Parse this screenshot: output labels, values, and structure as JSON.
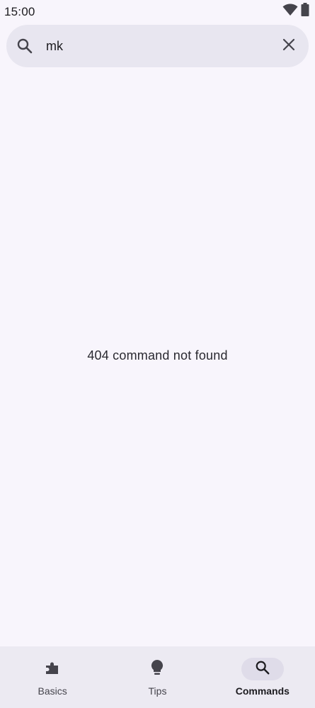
{
  "status_bar": {
    "time": "15:00",
    "icons": [
      "wifi-icon",
      "battery-icon"
    ]
  },
  "search": {
    "value": "mk",
    "placeholder": "",
    "icon": "search-icon",
    "clear_icon": "close-icon"
  },
  "main": {
    "message": "404 command not found"
  },
  "bottom_nav": {
    "items": [
      {
        "label": "Basics",
        "icon": "puzzle-icon",
        "active": false
      },
      {
        "label": "Tips",
        "icon": "lightbulb-icon",
        "active": false
      },
      {
        "label": "Commands",
        "icon": "search-icon",
        "active": true
      }
    ]
  },
  "colors": {
    "background": "#f8f5fc",
    "search_bar": "#e8e6f0",
    "nav_bar": "#eceaf2",
    "active_pill": "#dfdce9",
    "icon": "#45444c"
  }
}
